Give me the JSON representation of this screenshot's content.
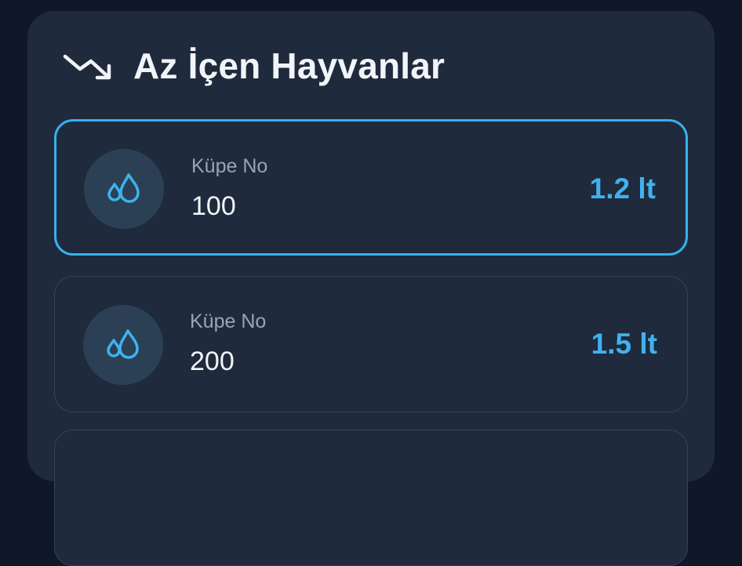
{
  "header": {
    "title": "Az İçen Hayvanlar",
    "icon": "trending-down-icon"
  },
  "colors": {
    "background": "#0f1729",
    "panel": "#1f2a3c",
    "accent": "#37b1ee",
    "badge": "#2b4054",
    "label": "#9aa5b4",
    "text": "#f1f4f8"
  },
  "animals": [
    {
      "ear_tag_label": "Küpe No",
      "ear_tag": "100",
      "amount": "1.2 lt",
      "selected": true,
      "icon": "water-drops-icon"
    },
    {
      "ear_tag_label": "Küpe No",
      "ear_tag": "200",
      "amount": "1.5 lt",
      "selected": false,
      "icon": "water-drops-icon"
    }
  ]
}
